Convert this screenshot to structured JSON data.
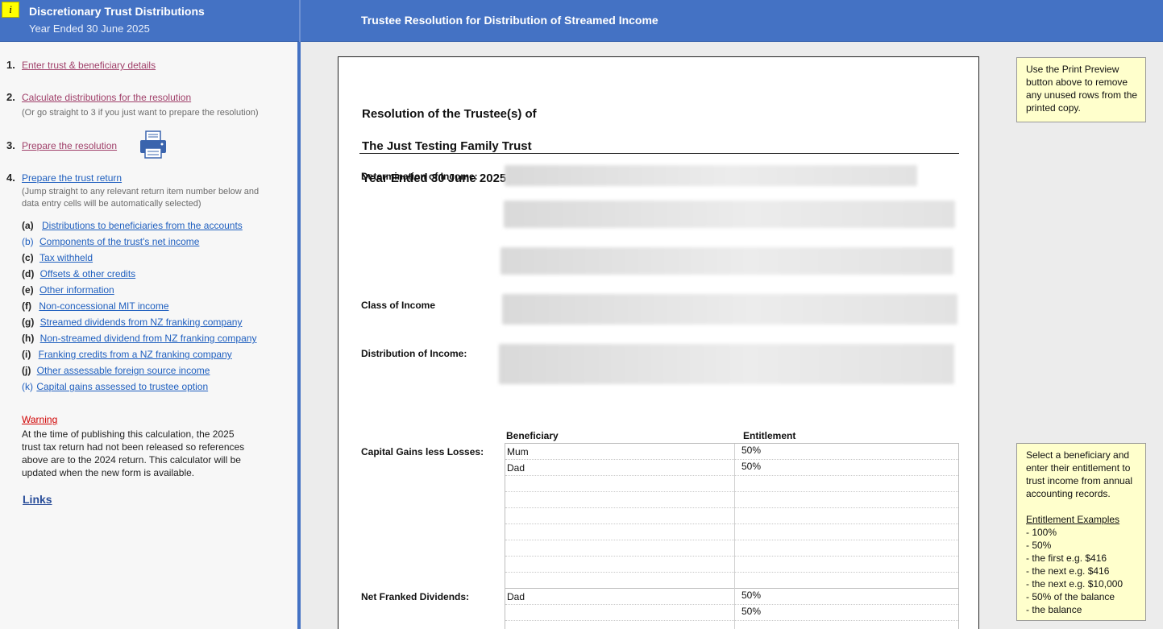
{
  "header": {
    "info_icon_glyph": "i",
    "app_title": "Discretionary Trust Distributions",
    "app_subtitle": "Year Ended 30 June 2025",
    "page_title": "Trustee Resolution for Distribution of Streamed Income"
  },
  "sidebar": {
    "steps": [
      {
        "num": "1.",
        "label": "Enter trust & beneficiary details"
      },
      {
        "num": "2.",
        "label": "Calculate distributions for the resolution",
        "note": "(Or go straight to 3 if you just want to prepare the resolution)"
      },
      {
        "num": "3.",
        "label": "Prepare the resolution"
      },
      {
        "num": "4.",
        "label": "Prepare the trust return",
        "note_line1": "(Jump straight to any relevant return item number below and",
        "note_line2": "data entry cells will be automatically selected)"
      }
    ],
    "items": [
      {
        "letter": "(a)",
        "label": "Distributions to beneficiaries from the accounts"
      },
      {
        "letter": "(b)",
        "label": "Components of the trust's net income"
      },
      {
        "letter": "(c)",
        "label": "Tax withheld"
      },
      {
        "letter": "(d)",
        "label": "Offsets & other credits"
      },
      {
        "letter": "(e)",
        "label": "Other information"
      },
      {
        "letter": "(f)",
        "label": "Non-concessional MIT income"
      },
      {
        "letter": "(g)",
        "label": "Streamed dividends from NZ franking company"
      },
      {
        "letter": "(h)",
        "label": "Non-streamed dividend from NZ franking company"
      },
      {
        "letter": "(i)",
        "label": "Franking credits from a NZ franking company"
      },
      {
        "letter": "(j)",
        "label": "Other assessable foreign source income"
      },
      {
        "letter": "(k)",
        "label": "Capital gains assessed to trustee option"
      }
    ],
    "warning_title": "Warning",
    "warning_line1": "At the time of publishing this calculation, the 2025",
    "warning_line2": "trust tax return had not been released so references",
    "warning_line3": "above are to the 2024 return.  This calculator will be",
    "warning_line4": "updated when the new form is available.",
    "links_label": "Links",
    "print_icon": "printer-icon"
  },
  "document": {
    "title_line1": "Resolution of the Trustee(s) of",
    "title_line2": "The Just Testing Family Trust",
    "title_line3": "Year Ended 30 June 2025",
    "determination_label": "Determination of Income:",
    "class_label": "Class of Income",
    "distribution_label": "Distribution of Income:",
    "capital_gains_label": "Capital Gains less Losses:",
    "net_franked_label": "Net Franked Dividends:",
    "col_beneficiary": "Beneficiary",
    "col_entitlement": "Entitlement",
    "capital_gains_rows": [
      {
        "beneficiary": "Mum",
        "entitlement": "50%"
      },
      {
        "beneficiary": "Dad",
        "entitlement": "50%"
      },
      {
        "beneficiary": "",
        "entitlement": ""
      },
      {
        "beneficiary": "",
        "entitlement": ""
      },
      {
        "beneficiary": "",
        "entitlement": ""
      },
      {
        "beneficiary": "",
        "entitlement": ""
      },
      {
        "beneficiary": "",
        "entitlement": ""
      },
      {
        "beneficiary": "",
        "entitlement": ""
      },
      {
        "beneficiary": "",
        "entitlement": ""
      }
    ],
    "net_franked_rows": [
      {
        "beneficiary": "Dad",
        "entitlement": "50%"
      },
      {
        "beneficiary": "",
        "entitlement": "50%"
      },
      {
        "beneficiary": "",
        "entitlement": ""
      }
    ]
  },
  "notes": {
    "print_preview": {
      "line1": "Use the Print Preview",
      "line2": "button above to remove",
      "line3": "any unused rows from the",
      "line4": "printed copy."
    },
    "select_beneficiary": {
      "line1": "Select a beneficiary and",
      "line2": "enter their entitlement to",
      "line3": "trust income from annual",
      "line4": "accounting records.",
      "examples_title": "Entitlement Examples ",
      "examples": [
        "- 100%",
        "- 50%",
        "- the first e.g. $416",
        "- the next e.g. $416",
        "- the next e.g. $10,000",
        "- 50% of the balance",
        "- the balance"
      ]
    }
  },
  "colors": {
    "header_blue": "#4472c4",
    "link_maroon": "#a0406a",
    "link_blue": "#1f5fbf",
    "note_yellow": "#ffffcc",
    "warning_red": "#d00000"
  }
}
